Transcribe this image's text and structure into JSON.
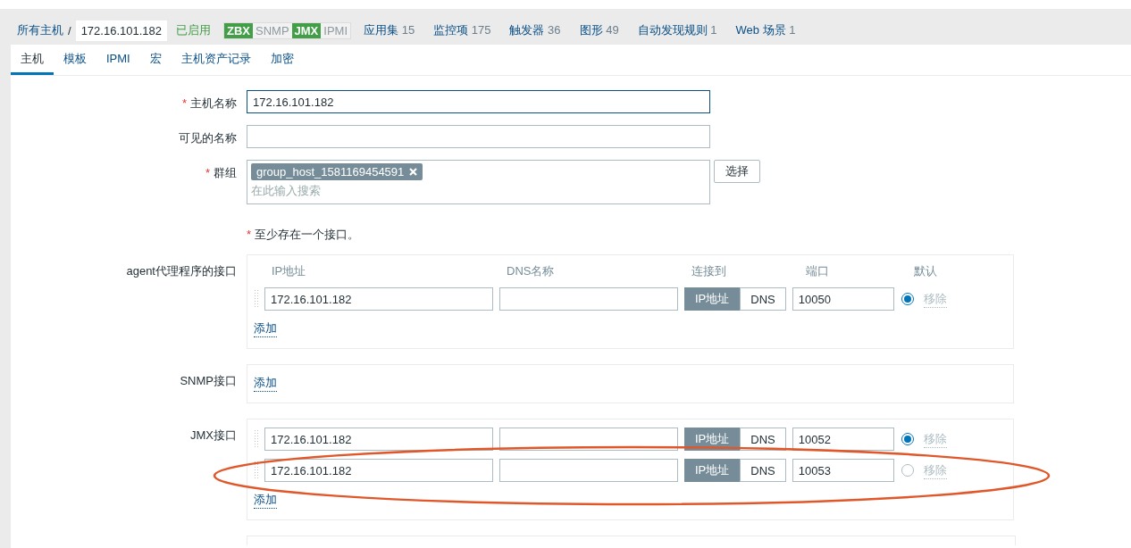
{
  "breadcrumb": {
    "root": "所有主机",
    "separator": "/",
    "current": "172.16.101.182",
    "status": "已启用"
  },
  "availability": [
    {
      "label": "ZBX",
      "on": true
    },
    {
      "label": "SNMP",
      "on": false
    },
    {
      "label": "JMX",
      "on": true
    },
    {
      "label": "IPMI",
      "on": false
    }
  ],
  "links": [
    {
      "label": "应用集",
      "count": "15"
    },
    {
      "label": "监控项",
      "count": "175"
    },
    {
      "label": "触发器",
      "count": "36"
    },
    {
      "label": "图形",
      "count": "49"
    },
    {
      "label": "自动发现规则",
      "count": "1"
    },
    {
      "label": "Web 场景",
      "count": "1"
    }
  ],
  "tabs": [
    {
      "label": "主机",
      "selected": true
    },
    {
      "label": "模板",
      "selected": false
    },
    {
      "label": "IPMI",
      "selected": false
    },
    {
      "label": "宏",
      "selected": false
    },
    {
      "label": "主机资产记录",
      "selected": false
    },
    {
      "label": "加密",
      "selected": false
    }
  ],
  "form": {
    "required_mark": "*",
    "host_name": {
      "label": "主机名称",
      "required": true,
      "value": "172.16.101.182"
    },
    "visible_name": {
      "label": "可见的名称",
      "required": false
    },
    "groups": {
      "label": "群组",
      "required": true,
      "tags": [
        "group_host_1581169454591"
      ],
      "placeholder": "在此输入搜索",
      "select_button": "选择"
    },
    "note_mark": "*",
    "note": "至少存在一个接口。"
  },
  "interface_columns": [
    "IP地址",
    "DNS名称",
    "连接到",
    "端口",
    "默认"
  ],
  "interfaces": [
    {
      "label": "agent代理程序的接口",
      "show_header": true,
      "add_link": "添加",
      "rows": [
        {
          "ip": "172.16.101.182",
          "connect": [
            {
              "label": "IP地址",
              "selected": true
            },
            {
              "label": "DNS",
              "selected": false
            }
          ],
          "port": "10050",
          "default": true,
          "remove": "移除"
        }
      ]
    },
    {
      "label": "SNMP接口",
      "show_header": false,
      "add_link": "添加"
    },
    {
      "label": "JMX接口",
      "show_header": false,
      "add_link": "添加",
      "rows": [
        {
          "ip": "172.16.101.182",
          "connect": [
            {
              "label": "IP地址",
              "selected": true
            },
            {
              "label": "DNS",
              "selected": false
            }
          ],
          "port": "10052",
          "default": true,
          "remove": "移除"
        },
        {
          "ip": "172.16.101.182",
          "connect": [
            {
              "label": "IP地址",
              "selected": true
            },
            {
              "label": "DNS",
              "selected": false
            }
          ],
          "port": "10053",
          "default": false,
          "remove": "移除",
          "highlighted": true
        }
      ]
    }
  ]
}
